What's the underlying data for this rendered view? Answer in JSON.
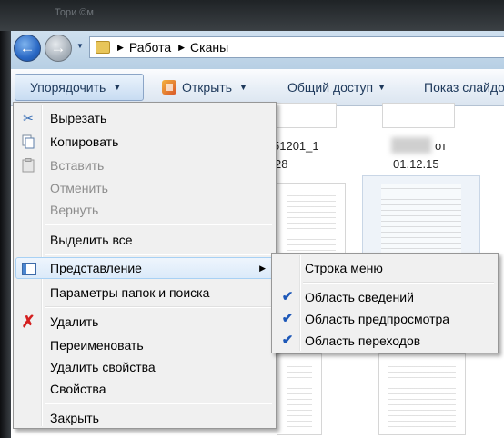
{
  "window": {
    "title_ghost": "Тори ©м"
  },
  "address": {
    "crumbs": [
      "Работа",
      "Сканы"
    ]
  },
  "toolbar": {
    "organize": "Упорядочить",
    "open": "Открыть",
    "share": "Общий доступ",
    "slideshow": "Показ слайдо"
  },
  "files": {
    "label1_line1": "51201_1",
    "label1_line2": "28",
    "label2_line1": "от",
    "label2_line2": "01.12.15"
  },
  "menu": {
    "cut": "Вырезать",
    "copy": "Копировать",
    "paste": "Вставить",
    "undo": "Отменить",
    "redo": "Вернуть",
    "select_all": "Выделить все",
    "layout": "Представление",
    "folder_options": "Параметры папок и поиска",
    "delete": "Удалить",
    "rename": "Переименовать",
    "remove_properties": "Удалить свойства",
    "properties": "Свойства",
    "close": "Закрыть"
  },
  "submenu": {
    "menu_bar": "Строка меню",
    "details_pane": "Область сведений",
    "preview_pane": "Область предпросмотра",
    "navigation_pane": "Область переходов"
  },
  "icons": {
    "cut": "scissors-icon",
    "copy": "copy-icon",
    "paste": "clipboard-icon",
    "layout": "layout-icon",
    "delete": "delete-x-icon",
    "check": "checkmark-icon"
  },
  "colors": {
    "accent": "#1d58b8",
    "delete_red": "#d42020"
  }
}
